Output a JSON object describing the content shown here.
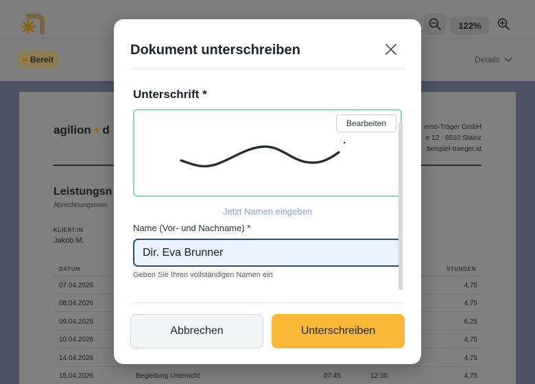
{
  "toolbar": {
    "zoom_level": "122%",
    "status_badge": "Bereit",
    "details_label": "Details"
  },
  "document": {
    "brand_left": "agilion",
    "brand_right": "d",
    "sender_lines": [
      "emo-Träger GmbH",
      "e 12 · 8510 Stainz",
      "beispiel-traeger.at"
    ],
    "title": "Leistungsn",
    "subtitle": "Abrechnungsmon",
    "client_label": "KLIENT:IN",
    "client_name": "Jakob M.",
    "col_date": "DATUM",
    "col_hours": "STUNDEN",
    "rows": [
      {
        "date": "07.04.2026",
        "activity": "",
        "from": "",
        "to": "",
        "hours": "4,75"
      },
      {
        "date": "08.04.2026",
        "activity": "",
        "from": "",
        "to": "",
        "hours": "4,75"
      },
      {
        "date": "09.04.2026",
        "activity": "",
        "from": "",
        "to": "",
        "hours": "6,25"
      },
      {
        "date": "10.04.2026",
        "activity": "",
        "from": "",
        "to": "",
        "hours": "4,75"
      },
      {
        "date": "14.04.2026",
        "activity": "",
        "from": "",
        "to": "",
        "hours": "4,75"
      },
      {
        "date": "15.04.2026",
        "activity": "Begleitung Unterricht",
        "from": "07:45",
        "to": "12:30",
        "hours": "4,75"
      }
    ]
  },
  "modal": {
    "title": "Dokument unterschreiben",
    "signature_label": "Unterschrift *",
    "edit_label": "Bearbeiten",
    "enter_name_link": "Jetzt Namen eingeben",
    "name_label": "Name (Vor- und Nachname) *",
    "name_value": "Dir. Eva Brunner",
    "name_hint": "Geben Sie Ihren vollständigen Namen ein",
    "cancel_label": "Abbrechen",
    "sign_label": "Unterschreiben"
  },
  "colors": {
    "accent": "#f9b936",
    "signature_border": "#86e0a5",
    "input_border": "#2b4a80",
    "link": "#8aa5e0"
  },
  "icons": {
    "logo": "brand-sun-icon",
    "zoom_out": "zoom-out-icon",
    "zoom_in": "zoom-in-icon",
    "details": "chevron-down-icon",
    "close": "close-icon"
  }
}
